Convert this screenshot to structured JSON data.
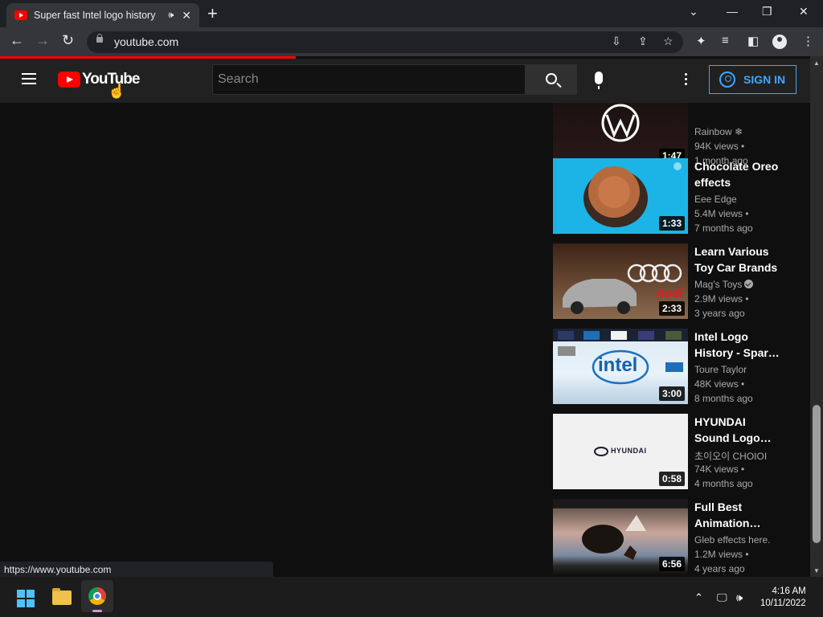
{
  "browser": {
    "tab_title": "Super fast Intel logo history",
    "tab_audio": "🕪",
    "tab_close": "✕",
    "new_tab": "+",
    "url": "youtube.com",
    "status_url": "https://www.youtube.com"
  },
  "youtube": {
    "logo_text": "YouTube",
    "search_placeholder": "Search",
    "signin_label": "SIGN IN"
  },
  "videos": [
    {
      "title": "",
      "channel": "Rainbow ❄",
      "views": "94K views •",
      "age": "1 month ago",
      "duration": "1:47",
      "verified": false
    },
    {
      "title": "Chocolate Oreo effects",
      "channel": "Eee Edge",
      "views": "5.4M views •",
      "age": "7 months ago",
      "duration": "1:33",
      "verified": false
    },
    {
      "title": "Learn Various Toy Car Brands",
      "channel": "Mag's Toys",
      "views": "2.9M views •",
      "age": "3 years ago",
      "duration": "2:33",
      "verified": true
    },
    {
      "title": "Intel Logo History - Spar…",
      "channel": "Toure Taylor",
      "views": "48K views •",
      "age": "8 months ago",
      "duration": "3:00",
      "verified": false
    },
    {
      "title": "HYUNDAI Sound Logo…",
      "channel": "초이오이 CHOIOI",
      "views": "74K views •",
      "age": "4 months ago",
      "duration": "0:58",
      "verified": false
    },
    {
      "title": "Full Best Animation…",
      "channel": "Gleb effects here.",
      "views": "1.2M views •",
      "age": "4 years ago",
      "duration": "6:56",
      "verified": false
    }
  ],
  "thumb_text": {
    "audi": "Audi",
    "intel": "intel",
    "hyundai": "HYUNDAI"
  },
  "taskbar": {
    "time": "4:16 AM",
    "date": "10/11/2022"
  },
  "colors": {
    "accent_red": "#ff0000",
    "signin_blue": "#3ea6ff",
    "page_bg": "#0f0f0f"
  }
}
